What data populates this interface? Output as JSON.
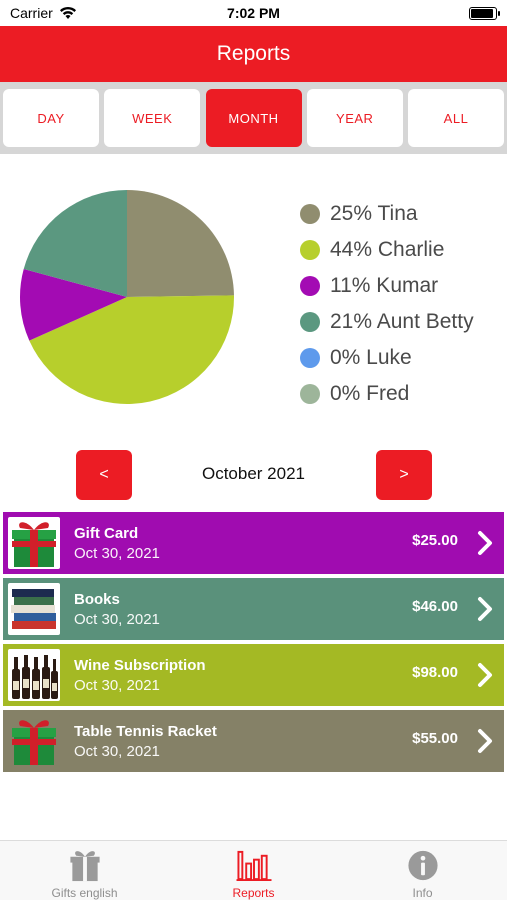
{
  "status_bar": {
    "carrier": "Carrier",
    "time": "7:02 PM"
  },
  "header": {
    "title": "Reports"
  },
  "segments": [
    {
      "label": "DAY",
      "active": false
    },
    {
      "label": "WEEK",
      "active": false
    },
    {
      "label": "MONTH",
      "active": true
    },
    {
      "label": "YEAR",
      "active": false
    },
    {
      "label": "ALL",
      "active": false
    }
  ],
  "chart_data": {
    "type": "pie",
    "slices": [
      {
        "label": "25% Tina",
        "name": "Tina",
        "value": 25,
        "color": "#908d6f"
      },
      {
        "label": "44% Charlie",
        "name": "Charlie",
        "value": 44,
        "color": "#b7cf2c"
      },
      {
        "label": "11% Kumar",
        "name": "Kumar",
        "value": 11,
        "color": "#a30bb3"
      },
      {
        "label": "21% Aunt Betty",
        "name": "Aunt Betty",
        "value": 21,
        "color": "#5b9880"
      },
      {
        "label": "0% Luke",
        "name": "Luke",
        "value": 0,
        "color": "#5e9aec"
      },
      {
        "label": "0% Fred",
        "name": "Fred",
        "value": 0,
        "color": "#9db59a"
      }
    ],
    "legend_position": "right"
  },
  "month_nav": {
    "prev_label": "<",
    "next_label": ">",
    "current": "October 2021"
  },
  "gifts": [
    {
      "name": "Gift Card",
      "date": "Oct 30, 2021",
      "price": "$25.00",
      "color": "#a00cb0",
      "thumb": "gift-box-icon"
    },
    {
      "name": "Books",
      "date": "Oct 30, 2021",
      "price": "$46.00",
      "color": "#5a917b",
      "thumb": "books-icon"
    },
    {
      "name": "Wine Subscription",
      "date": "Oct 30, 2021",
      "price": "$98.00",
      "color": "#a4b924",
      "thumb": "wine-bottles-icon"
    },
    {
      "name": "Table Tennis Racket",
      "date": "Oct 30, 2021",
      "price": "$55.00",
      "color": "#858167",
      "thumb": "gift-box-icon"
    }
  ],
  "tabs": [
    {
      "label": "Gifts english",
      "icon": "gift-icon",
      "active": false
    },
    {
      "label": "Reports",
      "icon": "bar-chart-icon",
      "active": true
    },
    {
      "label": "Info",
      "icon": "info-icon",
      "active": false
    }
  ],
  "colors": {
    "accent": "#ec1c24",
    "segment_bg": "#d6d6d6"
  }
}
